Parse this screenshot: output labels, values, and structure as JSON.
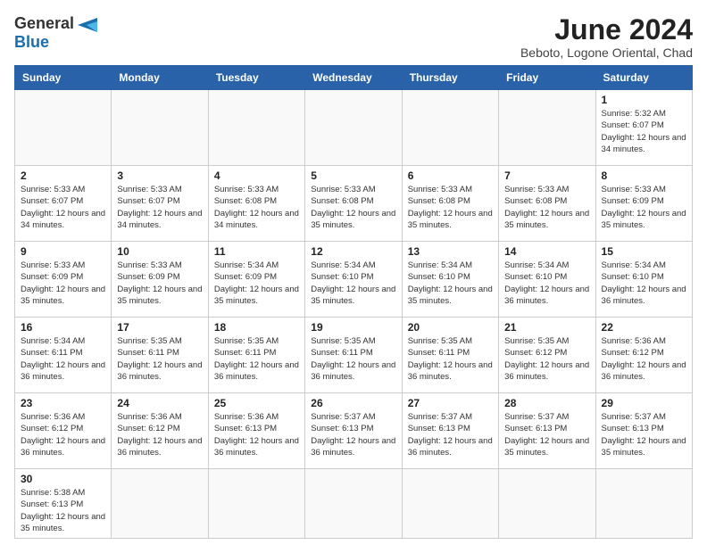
{
  "header": {
    "logo_general": "General",
    "logo_blue": "Blue",
    "month_year": "June 2024",
    "location": "Beboto, Logone Oriental, Chad"
  },
  "weekdays": [
    "Sunday",
    "Monday",
    "Tuesday",
    "Wednesday",
    "Thursday",
    "Friday",
    "Saturday"
  ],
  "weeks": [
    [
      {
        "day": "",
        "info": ""
      },
      {
        "day": "",
        "info": ""
      },
      {
        "day": "",
        "info": ""
      },
      {
        "day": "",
        "info": ""
      },
      {
        "day": "",
        "info": ""
      },
      {
        "day": "",
        "info": ""
      },
      {
        "day": "1",
        "info": "Sunrise: 5:32 AM\nSunset: 6:07 PM\nDaylight: 12 hours and 34 minutes."
      }
    ],
    [
      {
        "day": "2",
        "info": "Sunrise: 5:33 AM\nSunset: 6:07 PM\nDaylight: 12 hours and 34 minutes."
      },
      {
        "day": "3",
        "info": "Sunrise: 5:33 AM\nSunset: 6:07 PM\nDaylight: 12 hours and 34 minutes."
      },
      {
        "day": "4",
        "info": "Sunrise: 5:33 AM\nSunset: 6:08 PM\nDaylight: 12 hours and 34 minutes."
      },
      {
        "day": "5",
        "info": "Sunrise: 5:33 AM\nSunset: 6:08 PM\nDaylight: 12 hours and 35 minutes."
      },
      {
        "day": "6",
        "info": "Sunrise: 5:33 AM\nSunset: 6:08 PM\nDaylight: 12 hours and 35 minutes."
      },
      {
        "day": "7",
        "info": "Sunrise: 5:33 AM\nSunset: 6:08 PM\nDaylight: 12 hours and 35 minutes."
      },
      {
        "day": "8",
        "info": "Sunrise: 5:33 AM\nSunset: 6:09 PM\nDaylight: 12 hours and 35 minutes."
      }
    ],
    [
      {
        "day": "9",
        "info": "Sunrise: 5:33 AM\nSunset: 6:09 PM\nDaylight: 12 hours and 35 minutes."
      },
      {
        "day": "10",
        "info": "Sunrise: 5:33 AM\nSunset: 6:09 PM\nDaylight: 12 hours and 35 minutes."
      },
      {
        "day": "11",
        "info": "Sunrise: 5:34 AM\nSunset: 6:09 PM\nDaylight: 12 hours and 35 minutes."
      },
      {
        "day": "12",
        "info": "Sunrise: 5:34 AM\nSunset: 6:10 PM\nDaylight: 12 hours and 35 minutes."
      },
      {
        "day": "13",
        "info": "Sunrise: 5:34 AM\nSunset: 6:10 PM\nDaylight: 12 hours and 35 minutes."
      },
      {
        "day": "14",
        "info": "Sunrise: 5:34 AM\nSunset: 6:10 PM\nDaylight: 12 hours and 36 minutes."
      },
      {
        "day": "15",
        "info": "Sunrise: 5:34 AM\nSunset: 6:10 PM\nDaylight: 12 hours and 36 minutes."
      }
    ],
    [
      {
        "day": "16",
        "info": "Sunrise: 5:34 AM\nSunset: 6:11 PM\nDaylight: 12 hours and 36 minutes."
      },
      {
        "day": "17",
        "info": "Sunrise: 5:35 AM\nSunset: 6:11 PM\nDaylight: 12 hours and 36 minutes."
      },
      {
        "day": "18",
        "info": "Sunrise: 5:35 AM\nSunset: 6:11 PM\nDaylight: 12 hours and 36 minutes."
      },
      {
        "day": "19",
        "info": "Sunrise: 5:35 AM\nSunset: 6:11 PM\nDaylight: 12 hours and 36 minutes."
      },
      {
        "day": "20",
        "info": "Sunrise: 5:35 AM\nSunset: 6:11 PM\nDaylight: 12 hours and 36 minutes."
      },
      {
        "day": "21",
        "info": "Sunrise: 5:35 AM\nSunset: 6:12 PM\nDaylight: 12 hours and 36 minutes."
      },
      {
        "day": "22",
        "info": "Sunrise: 5:36 AM\nSunset: 6:12 PM\nDaylight: 12 hours and 36 minutes."
      }
    ],
    [
      {
        "day": "23",
        "info": "Sunrise: 5:36 AM\nSunset: 6:12 PM\nDaylight: 12 hours and 36 minutes."
      },
      {
        "day": "24",
        "info": "Sunrise: 5:36 AM\nSunset: 6:12 PM\nDaylight: 12 hours and 36 minutes."
      },
      {
        "day": "25",
        "info": "Sunrise: 5:36 AM\nSunset: 6:13 PM\nDaylight: 12 hours and 36 minutes."
      },
      {
        "day": "26",
        "info": "Sunrise: 5:37 AM\nSunset: 6:13 PM\nDaylight: 12 hours and 36 minutes."
      },
      {
        "day": "27",
        "info": "Sunrise: 5:37 AM\nSunset: 6:13 PM\nDaylight: 12 hours and 36 minutes."
      },
      {
        "day": "28",
        "info": "Sunrise: 5:37 AM\nSunset: 6:13 PM\nDaylight: 12 hours and 35 minutes."
      },
      {
        "day": "29",
        "info": "Sunrise: 5:37 AM\nSunset: 6:13 PM\nDaylight: 12 hours and 35 minutes."
      }
    ],
    [
      {
        "day": "30",
        "info": "Sunrise: 5:38 AM\nSunset: 6:13 PM\nDaylight: 12 hours and 35 minutes."
      },
      {
        "day": "",
        "info": ""
      },
      {
        "day": "",
        "info": ""
      },
      {
        "day": "",
        "info": ""
      },
      {
        "day": "",
        "info": ""
      },
      {
        "day": "",
        "info": ""
      },
      {
        "day": "",
        "info": ""
      }
    ]
  ]
}
